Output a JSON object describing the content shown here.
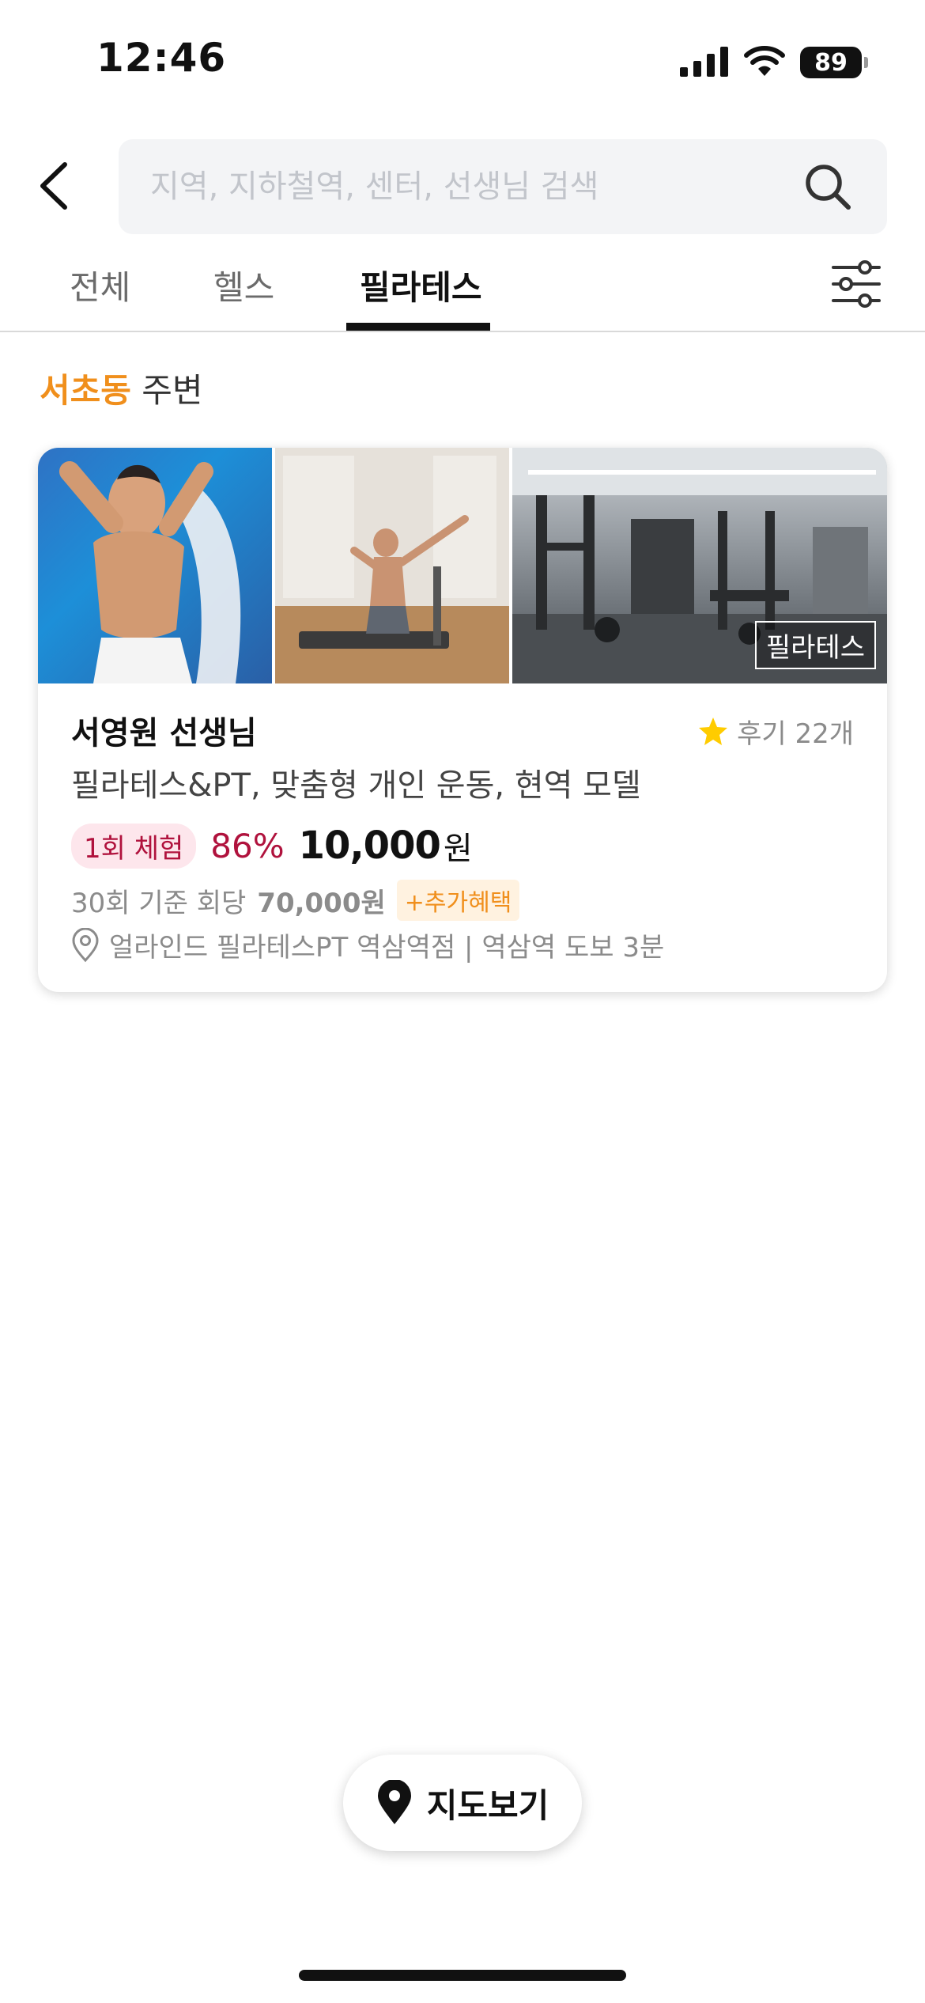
{
  "status_bar": {
    "time": "12:46",
    "battery": "89"
  },
  "search": {
    "placeholder": "지역, 지하철역, 센터, 선생님 검색"
  },
  "tabs": [
    {
      "label": "전체",
      "active": false
    },
    {
      "label": "헬스",
      "active": false
    },
    {
      "label": "필라테스",
      "active": true
    }
  ],
  "location": {
    "area": "서초동",
    "suffix": "주변"
  },
  "listing": {
    "category_tag": "필라테스",
    "teacher_name": "서영원 선생님",
    "reviews": "후기 22개",
    "subtitle": "필라테스&PT, 맞춤형 개인 운동, 현역 모델",
    "trial_badge": "1회 체험",
    "discount": "86%",
    "price": "10,000",
    "price_unit": "원",
    "base_label": "30회 기준 회당",
    "base_price": "70,000원",
    "benefit_badge": "+추가혜택",
    "address": "얼라인드 필라테스PT 역삼역점 | 역삼역 도보 3분"
  },
  "map_button": {
    "label": "지도보기"
  },
  "colors": {
    "accent_orange": "#f08f1c",
    "discount_red": "#b0123d",
    "star": "#ffcc00"
  }
}
